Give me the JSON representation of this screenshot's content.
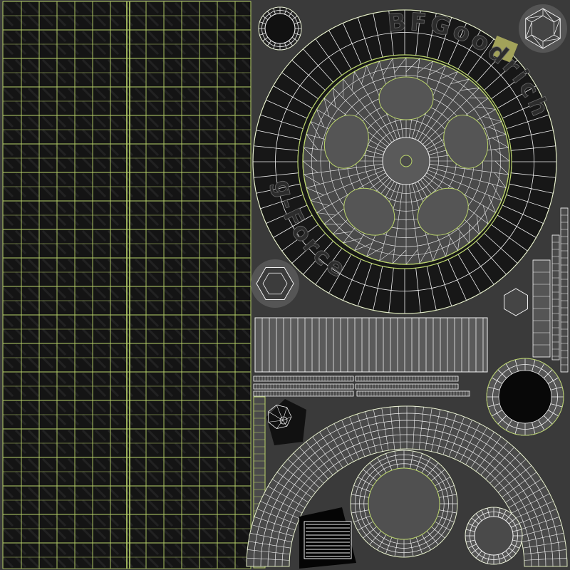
{
  "title": "",
  "tire_sidewall_text": {
    "brand": "BFGoodrich",
    "model": "g-Force"
  },
  "colors": {
    "background": "#3a3a3a",
    "panel_dark": "#151515",
    "panel_mid": "#4a4a4a",
    "panel_light": "#5a5a5a",
    "wire_green": "#b9d36a",
    "wire_white": "#f2f2f2",
    "highlight_square": "#a2a25a"
  }
}
